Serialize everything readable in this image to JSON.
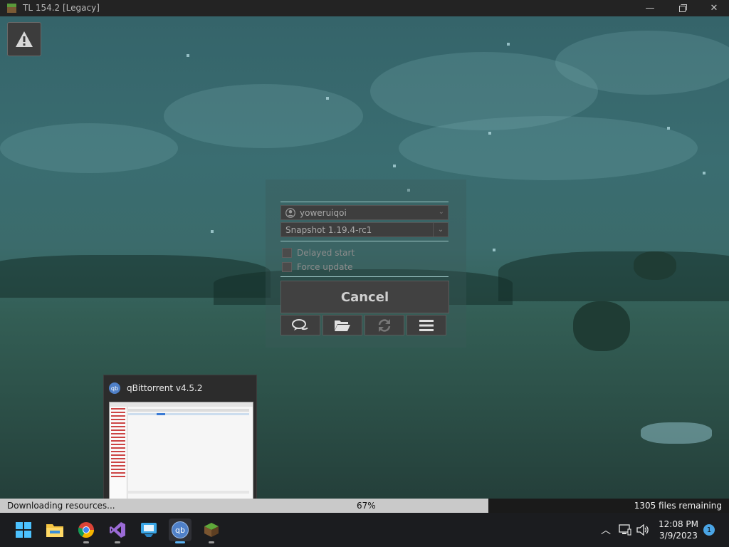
{
  "window": {
    "title": "TL 154.2 [Legacy]",
    "controls": [
      "minimize",
      "maximize",
      "close"
    ]
  },
  "launcher": {
    "account": "yoweruiqoi",
    "version": "Snapshot 1.19.4-rc1",
    "options": [
      {
        "label": "Delayed start",
        "checked": false
      },
      {
        "label": "Force update",
        "checked": false
      }
    ],
    "cancel_label": "Cancel",
    "icon_buttons": [
      "chat-icon",
      "folder-icon",
      "refresh-icon",
      "menu-icon"
    ]
  },
  "preview": {
    "title": "qBittorrent v4.5.2"
  },
  "progress": {
    "status": "Downloading resources...",
    "percent_label": "67%",
    "percent": 67,
    "remaining": "1305 files remaining"
  },
  "taskbar": {
    "apps": [
      "start-icon",
      "file-explorer-icon",
      "chrome-icon",
      "visual-studio-icon",
      "app-icon",
      "qbittorrent-icon",
      "minecraft-icon"
    ],
    "time": "12:08 PM",
    "date": "3/9/2023",
    "notification_count": "1"
  },
  "colors": {
    "accent": "#5ab3f5",
    "progress_fill": "#c9c9c9",
    "separator": "#9cc6c6"
  }
}
